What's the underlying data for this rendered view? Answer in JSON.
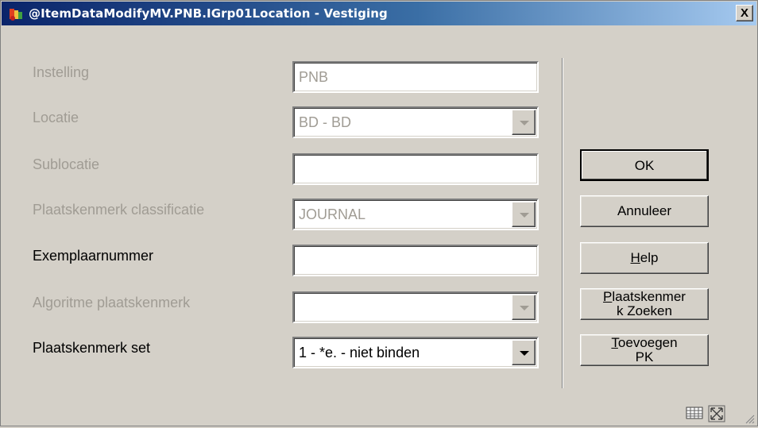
{
  "window": {
    "title": "@ItemDataModifyMV.PNB.IGrp01Location - Vestiging",
    "close_label": "X"
  },
  "form": {
    "rows": [
      {
        "label": "Instelling",
        "value": "PNB",
        "type": "text",
        "enabled": false
      },
      {
        "label": "Locatie",
        "value": "BD - BD",
        "type": "dropdown",
        "enabled": false
      },
      {
        "label": "Sublocatie",
        "value": "",
        "type": "text",
        "enabled": false
      },
      {
        "label": "Plaatskenmerk classificatie",
        "value": "JOURNAL",
        "type": "dropdown",
        "enabled": false
      },
      {
        "label": "Exemplaarnummer",
        "value": "",
        "type": "text",
        "enabled": true
      },
      {
        "label": "Algoritme plaatskenmerk",
        "value": "",
        "type": "dropdown",
        "enabled": false
      },
      {
        "label": "Plaatskenmerk set",
        "value": "1 - *e. - niet binden",
        "type": "dropdown",
        "enabled": true
      }
    ]
  },
  "buttons": {
    "ok": "OK",
    "cancel": "Annuleer",
    "help_mnemonic": "H",
    "help_rest": "elp",
    "find_line1_mnemonic": "P",
    "find_line1_rest": "laatskenmer",
    "find_line2": "k Zoeken",
    "add_line1_mnemonic": "T",
    "add_line1_rest": "oevoegen",
    "add_line2": "PK"
  },
  "icons": {
    "app": "library-app-icon",
    "status": [
      "keyboard-grid-icon",
      "maximize-resize-icon",
      "size-grip-icon"
    ]
  }
}
